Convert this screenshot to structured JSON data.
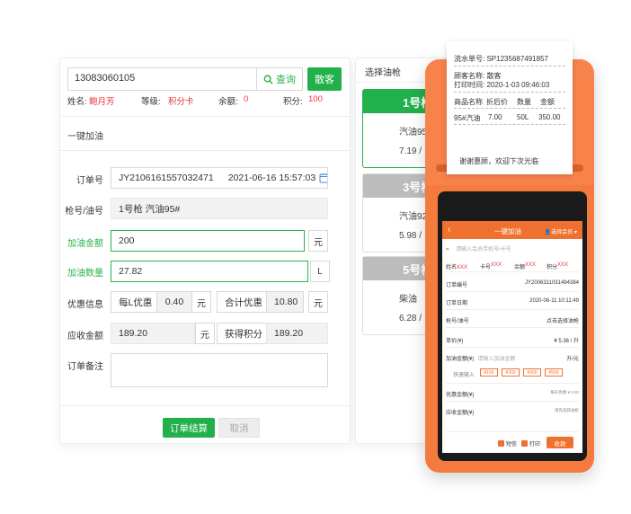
{
  "member": {
    "phone": "13083060105",
    "query_label": "查询",
    "guest_label": "散客",
    "name_label": "姓名:",
    "name": "鲍月芳",
    "level_label": "等级:",
    "level": "积分卡",
    "balance_label": "余额:",
    "balance": "0",
    "points_label": "积分:",
    "points": "100"
  },
  "section_title": "一键加油",
  "form": {
    "order_no_label": "订单号",
    "order_no": "JY2106161557032471",
    "order_time": "2021-06-16 15:57:03",
    "gun_label": "枪号/油号",
    "gun_value": "1号枪 汽油95#",
    "amount_label": "加油金额",
    "amount": "200",
    "amount_unit": "元",
    "qty_label": "加油数量",
    "qty": "27.82",
    "qty_unit": "L",
    "discount_label": "优惠信息",
    "per_l_label": "每L优惠",
    "per_l_value": "0.40",
    "per_l_unit": "元",
    "total_disc_label": "合计优惠",
    "total_disc_value": "10.80",
    "total_disc_unit": "元",
    "receivable_label": "应收金额",
    "receivable": "189.20",
    "receivable_unit": "元",
    "earn_points_label": "获得积分",
    "earn_points": "189.20",
    "remark_label": "订单备注",
    "submit_label": "订单结算",
    "cancel_label": "取消"
  },
  "pump_panel": {
    "title": "选择油枪",
    "cards": [
      {
        "head": "1号枪",
        "fuel": "汽油95",
        "price": "7.19 /",
        "color": "#22b04b"
      },
      {
        "head": "3号枪",
        "fuel": "汽油92",
        "price": "5.98 /",
        "color": "#bcbcbc"
      },
      {
        "head": "5号枪",
        "fuel": "柴油",
        "price": "6.28 /",
        "color": "#bcbcbc"
      }
    ]
  },
  "receipt": {
    "serial_label": "流水单号:",
    "serial": "SP1235687491857",
    "customer_label": "顾客名称:",
    "customer": "散客",
    "print_time_label": "打印时间:",
    "print_time": "2020-1-03  09:46:03",
    "col_name": "商品名称",
    "col_price": "折后价",
    "col_qty": "数量",
    "col_amount": "金额",
    "item_name": "95#汽油",
    "item_price": "7.00",
    "item_qty": "50L",
    "item_amount": "350.00",
    "thanks": "谢谢惠顾，欢迎下次光临"
  },
  "pos_screen": {
    "title": "一键加油",
    "select_member": "选择会员",
    "search_placeholder": "请输入会员手机号/卡号",
    "name_label": "姓名",
    "name_val": "XXX",
    "card_label": "卡号",
    "card_val": "XXX",
    "balance_label": "余额",
    "balance_val": "XXX",
    "points_label": "积分",
    "points_val": "XXX",
    "order_no_label": "订单编号",
    "order_no": "JY2006311031494384",
    "order_date_label": "订单日期",
    "order_date": "2020-06-11 10:11:49",
    "gun_label": "枪号/油号",
    "gun_hint": "点击选择油枪",
    "unit_price_label": "单价(¥)",
    "unit_price": "¥ 5.36 / 升",
    "amount_label": "加油金额(¥)",
    "amount_hint": "请输入加油金额",
    "amount_unit": "升/元",
    "quick_label": "快速输入",
    "chips": [
      "¥100",
      "¥200",
      "¥300",
      "¥500"
    ],
    "discount_label": "优惠金额(¥)",
    "discount_hint": "每升优惠 ¥ 0.00",
    "receivable_label": "应收金额(¥)",
    "receivable_hint": "请先选择油枪",
    "check_small_ticket": "短信",
    "check_print": "打印",
    "confirm_label": "收款"
  },
  "colors": {
    "accent_green": "#22b04b",
    "danger_red": "#e4393c",
    "device_orange": "#f47a3e"
  }
}
